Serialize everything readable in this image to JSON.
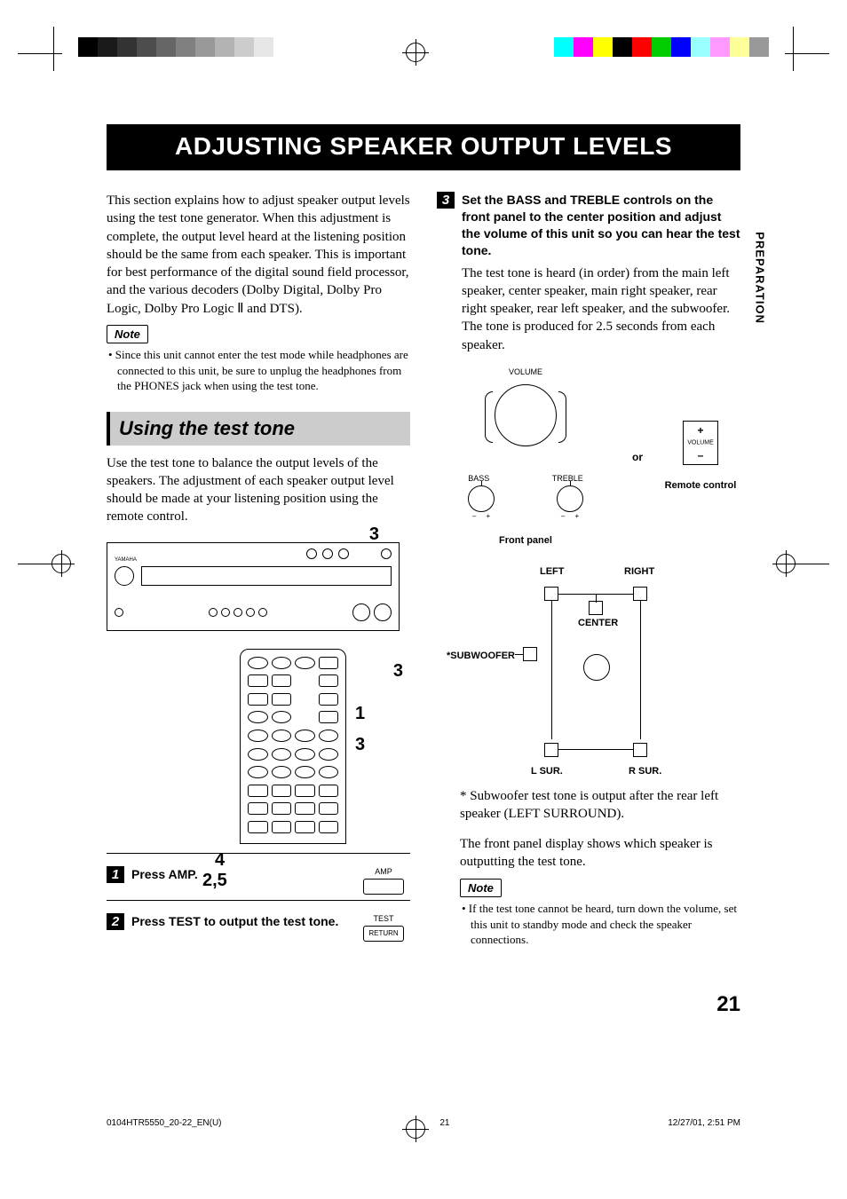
{
  "pageTitle": "ADJUSTING SPEAKER OUTPUT LEVELS",
  "sideTab": "PREPARATION",
  "intro": "This section explains how to adjust speaker output levels using the test tone generator. When this adjustment is complete, the output level heard at the listening position should be the same from each speaker. This is important for best performance of the digital sound field processor, and the various decoders (Dolby Digital, Dolby Pro Logic, Dolby Pro Logic Ⅱ and DTS).",
  "noteLabel": "Note",
  "note1": "• Since this unit cannot enter the test mode while headphones are connected to this unit, be sure to unplug the headphones from the PHONES jack when using the test tone.",
  "sectionTitle": "Using the test tone",
  "sectionIntro": "Use the test tone to balance the output levels of the speakers. The adjustment of each speaker output level should be made at your listening position using the remote control.",
  "callout": {
    "three_top": "3",
    "three_mid": "3",
    "one": "1",
    "three_r": "3",
    "four": "4",
    "twofive": "2,5"
  },
  "step1": {
    "num": "1",
    "text": "Press AMP.",
    "btn": "AMP"
  },
  "step2": {
    "num": "2",
    "text": "Press TEST to output the test tone.",
    "btn1": "TEST",
    "btn2": "RETURN"
  },
  "step3": {
    "num": "3",
    "text": "Set the BASS and TREBLE controls on the front panel to the center position and adjust the volume of this unit so you can hear the test tone.",
    "plain": "The test tone is heard (in order) from the main left speaker, center speaker, main right speaker, rear right speaker, rear left speaker, and the subwoofer. The tone is produced for 2.5 seconds from each speaker."
  },
  "controls": {
    "volume": "VOLUME",
    "bass": "BASS",
    "treble": "TREBLE",
    "or": "or",
    "front": "Front panel",
    "remote": "Remote control"
  },
  "speakers": {
    "left": "LEFT",
    "right": "RIGHT",
    "center": "CENTER",
    "subwoofer": "*SUBWOOFER",
    "lsur": "L SUR.",
    "rsur": "R SUR."
  },
  "footnote": "* Subwoofer test tone is output after the rear left speaker (LEFT SURROUND).",
  "displayNote": "The front panel display shows which speaker is outputting the test tone.",
  "note2": "• If the test tone cannot be heard, turn down the volume, set this unit to standby mode and check the speaker connections.",
  "pageNum": "21",
  "footer": {
    "file": "0104HTR5550_20-22_EN(U)",
    "page": "21",
    "date": "12/27/01, 2:51 PM"
  }
}
